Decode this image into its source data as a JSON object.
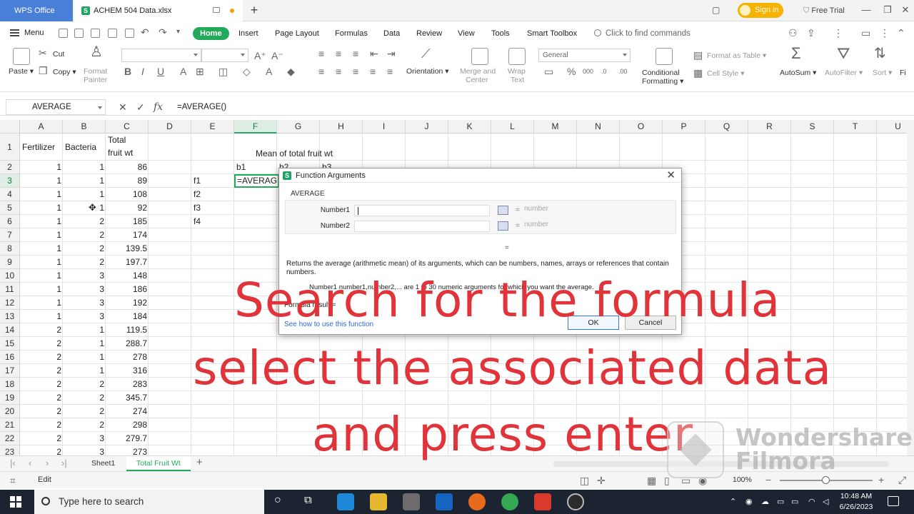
{
  "titlebar": {
    "app_tab": "WPS Office",
    "doc_tab": "ACHEM 504 Data.xlsx",
    "sign_in": "Sign in",
    "free_trial": "Free Trial"
  },
  "menu": {
    "menu_label": "Menu",
    "tabs": [
      "Home",
      "Insert",
      "Page Layout",
      "Formulas",
      "Data",
      "Review",
      "View",
      "Tools",
      "Smart Toolbox"
    ],
    "search_placeholder": "Click to find commands"
  },
  "ribbon": {
    "paste": "Paste",
    "cut": "Cut",
    "copy": "Copy",
    "format_painter_1": "Format",
    "format_painter_2": "Painter",
    "orientation": "Orientation",
    "merge_1": "Merge and",
    "merge_2": "Center",
    "wrap_1": "Wrap",
    "wrap_2": "Text",
    "number_format": "General",
    "format_as_table": "Format as Table",
    "cell_style": "Cell Style",
    "conditional_1": "Conditional",
    "conditional_2": "Formatting",
    "autosum": "AutoSum",
    "autofilter": "AutoFilter",
    "sort": "Sort",
    "fill": "Fi"
  },
  "formula_bar": {
    "name_box": "AVERAGE",
    "formula": "=AVERAGE()"
  },
  "sheet": {
    "columns": [
      "A",
      "B",
      "C",
      "D",
      "E",
      "F",
      "G",
      "H",
      "I",
      "J",
      "K",
      "L",
      "M",
      "N",
      "O",
      "P",
      "Q",
      "R",
      "S",
      "T",
      "U"
    ],
    "selected_column": "F",
    "selected_row": "3",
    "header_a": "Fertilizer",
    "header_b": "Bacteria",
    "header_c1": "Total",
    "header_c2": "fruit wt",
    "mean_title": "Mean of total fruit wt",
    "g2": "b1",
    "g2_partial_h": "b2",
    "g2_partial_i": "b3",
    "f_labels": [
      "f1",
      "f2",
      "f3",
      "f4"
    ],
    "active_cell_text": "=AVERAGE(",
    "rows": [
      {
        "n": "2",
        "a": "1",
        "b": "1",
        "c": "86"
      },
      {
        "n": "3",
        "a": "1",
        "b": "1",
        "c": "89"
      },
      {
        "n": "4",
        "a": "1",
        "b": "1",
        "c": "108"
      },
      {
        "n": "5",
        "a": "1",
        "b": "1",
        "c": "92"
      },
      {
        "n": "6",
        "a": "1",
        "b": "2",
        "c": "185"
      },
      {
        "n": "7",
        "a": "1",
        "b": "2",
        "c": "174"
      },
      {
        "n": "8",
        "a": "1",
        "b": "2",
        "c": "139.5"
      },
      {
        "n": "9",
        "a": "1",
        "b": "2",
        "c": "197.7"
      },
      {
        "n": "10",
        "a": "1",
        "b": "3",
        "c": "148"
      },
      {
        "n": "11",
        "a": "1",
        "b": "3",
        "c": "186"
      },
      {
        "n": "12",
        "a": "1",
        "b": "3",
        "c": "192"
      },
      {
        "n": "13",
        "a": "1",
        "b": "3",
        "c": "184"
      },
      {
        "n": "14",
        "a": "2",
        "b": "1",
        "c": "119.5"
      },
      {
        "n": "15",
        "a": "2",
        "b": "1",
        "c": "288.7"
      },
      {
        "n": "16",
        "a": "2",
        "b": "1",
        "c": "278"
      },
      {
        "n": "17",
        "a": "2",
        "b": "1",
        "c": "316"
      },
      {
        "n": "18",
        "a": "2",
        "b": "2",
        "c": "283"
      },
      {
        "n": "19",
        "a": "2",
        "b": "2",
        "c": "345.7"
      },
      {
        "n": "20",
        "a": "2",
        "b": "2",
        "c": "274"
      },
      {
        "n": "21",
        "a": "2",
        "b": "2",
        "c": "298"
      },
      {
        "n": "22",
        "a": "2",
        "b": "3",
        "c": "279.7"
      },
      {
        "n": "23",
        "a": "2",
        "b": "3",
        "c": "273"
      }
    ]
  },
  "sheet_tabs": [
    "Sheet1",
    "Total Fruit Wt"
  ],
  "active_sheet": "Total Fruit Wt",
  "status": {
    "mode": "Edit",
    "zoom": "100%"
  },
  "dialog": {
    "title": "Function Arguments",
    "function_name": "AVERAGE",
    "arg1_label": "Number1",
    "arg2_label": "Number2",
    "arg_hint": "number",
    "equals": "=",
    "description": "Returns the average (arithmetic mean) of its arguments, which can be numbers, names, arrays or references that contain numbers.",
    "arg_description": "Number1    number1,number2,... are 1 to 30 numeric arguments for which you want the average.",
    "formula_result": "Formula result  =",
    "help_link": "See how to use this function",
    "ok": "OK",
    "cancel": "Cancel"
  },
  "caption": {
    "line1": "Search for the formula",
    "line2": "select the associated data",
    "line3": "and press enter"
  },
  "watermark": {
    "line1": "Wondershare",
    "line2": "Filmora"
  },
  "taskbar": {
    "search_placeholder": "Type here to search",
    "time": "10:48 AM",
    "date": "6/26/2023"
  },
  "colors": {
    "accent_green": "#23a95a",
    "wps_blue": "#4a7fd8",
    "caption_red": "#e0333a",
    "signin_gold": "#f5b300"
  }
}
